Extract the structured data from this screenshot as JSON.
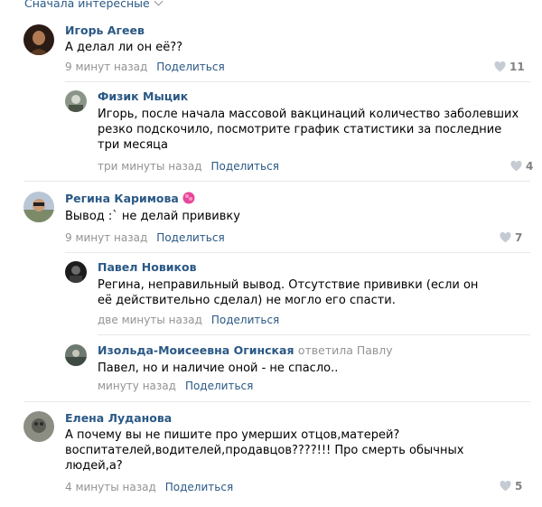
{
  "sort": {
    "label": "Сначала интересные"
  },
  "comments": [
    {
      "author": "Игорь Агеев",
      "text": "А делал ли он её??",
      "time": "9 минут назад",
      "share": "Поделиться",
      "likes": "11"
    },
    {
      "author": "Физик Мыцик",
      "text": "Игорь, после начала массовой вакцинаций количество заболевших резко подскочило, посмотрите график статистики за последние три месяца",
      "time": "три минуты назад",
      "share": "Поделиться",
      "likes": "4"
    },
    {
      "author": "Регина Каримова",
      "text": "Вывод :` не делай прививку",
      "time": "9 минут назад",
      "share": "Поделиться",
      "likes": "7"
    },
    {
      "author": "Павел Новиков",
      "text": "Регина, неправильный вывод. Отсутствие прививки (если он её действительно сделал) не могло его спасти.",
      "time": "две минуты назад",
      "share": "Поделиться"
    },
    {
      "author": "Изольда-Моисеевна Огинская",
      "reply_to": "ответила Павлу",
      "text": "Павел, но и наличие оной - не спасло..",
      "time": "минуту назад",
      "share": "Поделиться"
    },
    {
      "author": "Елена Луданова",
      "text": "А почему вы не пишите про умерших отцов,матерей? воспитателей,водителей,продавцов????!!! Про смерть обычных людей,а?",
      "time": "4 минуты назад",
      "share": "Поделиться",
      "likes": "5"
    }
  ]
}
